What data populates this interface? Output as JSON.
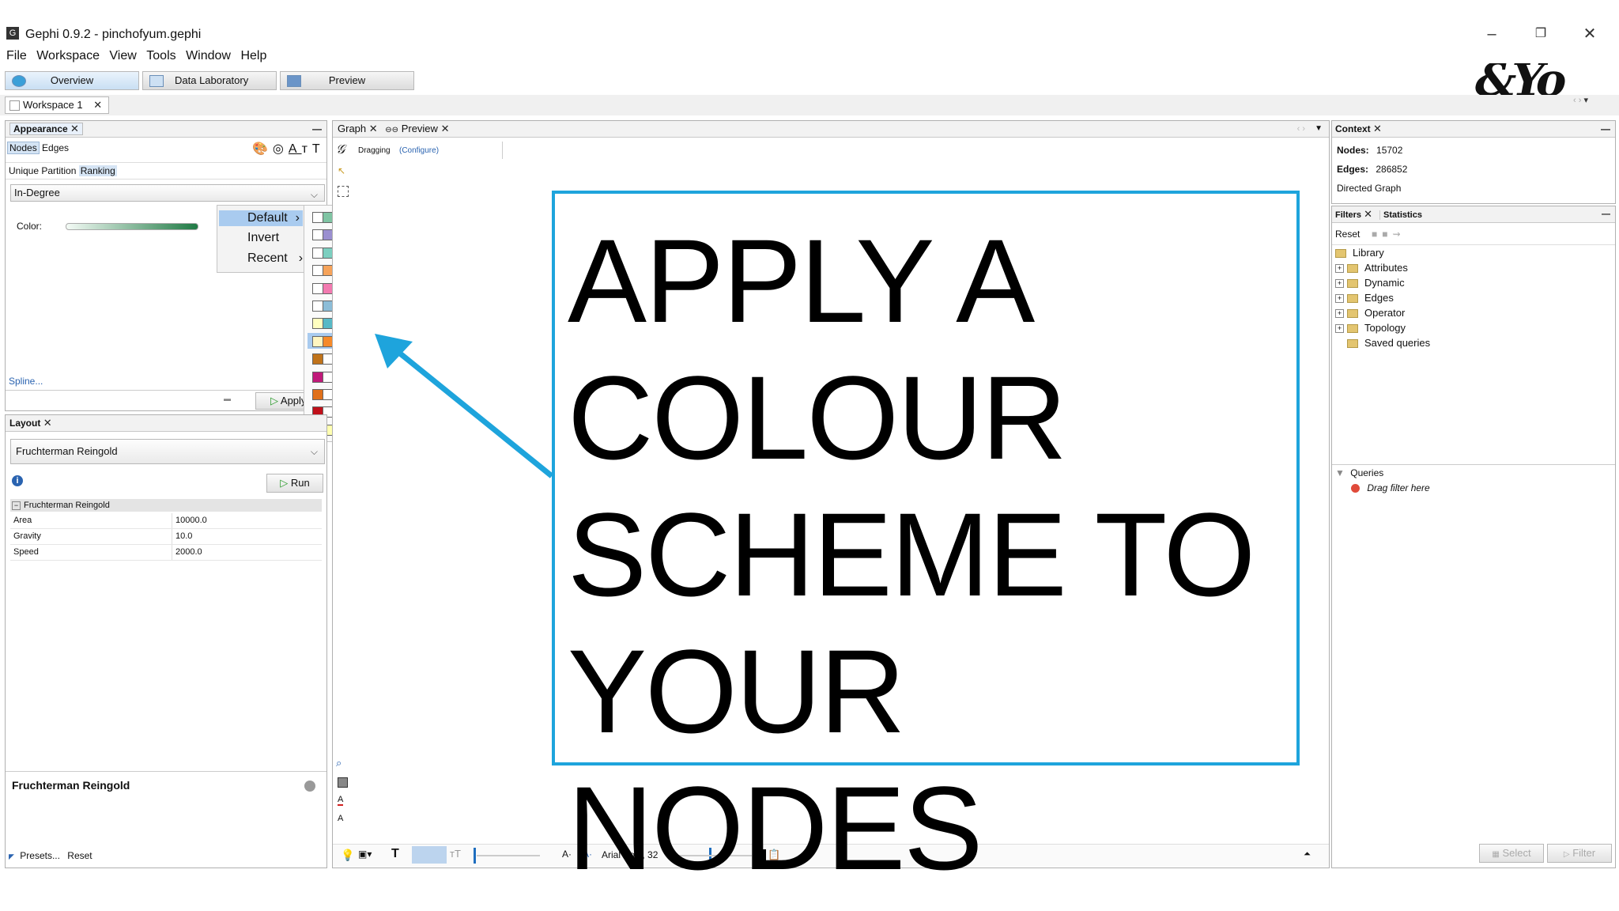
{
  "window": {
    "title": "Gephi 0.9.2 - pinchofyum.gephi",
    "app_icon": "gephi-logo-icon"
  },
  "menu": [
    "File",
    "Workspace",
    "View",
    "Tools",
    "Window",
    "Help"
  ],
  "perspectives": [
    {
      "label": "Overview",
      "active": true
    },
    {
      "label": "Data Laboratory"
    },
    {
      "label": "Preview"
    }
  ],
  "workspace_tab": "Workspace 1",
  "appearance": {
    "title": "Appearance",
    "target_tabs": [
      "Nodes",
      "Edges"
    ],
    "mode_tabs": [
      "Unique",
      "Partition",
      "Ranking"
    ],
    "attribute": "In-Degree",
    "color_label": "Color:",
    "spline_link": "Spline...",
    "apply_label": "Apply",
    "palette_menu": [
      "Default",
      "Invert",
      "Recent"
    ],
    "palettes": [
      [
        "#ffffff",
        "#7fc4a3",
        "#1f7a44"
      ],
      [
        "#ffffff",
        "#9a8fd0",
        "#7a1f8a"
      ],
      [
        "#ffffff",
        "#7ccfc0",
        "#1f6eaa"
      ],
      [
        "#ffffff",
        "#f6a35a",
        "#c41a1a"
      ],
      [
        "#ffffff",
        "#f27ab0",
        "#7a0f8a"
      ],
      [
        "#ffffff",
        "#8cbdd8",
        "#1f5590"
      ],
      [
        "#ffffc0",
        "#57b9c6",
        "#23318e"
      ],
      [
        "#fff5c0",
        "#f68a2a",
        "#a63a06"
      ],
      [
        "#c0731a",
        "#ffffff",
        "#1a8a7a"
      ],
      [
        "#c01a7a",
        "#ffffff",
        "#3aa01a"
      ],
      [
        "#e0701a",
        "#ffffff",
        "#6a4aa0"
      ],
      [
        "#c0101a",
        "#ffffff",
        "#404040"
      ],
      [
        "#d01a1a",
        "#ffffb0",
        "#2a6ab0"
      ]
    ]
  },
  "layout": {
    "title": "Layout",
    "algorithm": "Fruchterman Reingold",
    "run_label": "Run",
    "section": "Fruchterman Reingold",
    "properties": [
      {
        "name": "Area",
        "value": "10000.0"
      },
      {
        "name": "Gravity",
        "value": "10.0"
      },
      {
        "name": "Speed",
        "value": "2000.0"
      }
    ],
    "description_title": "Fruchterman Reingold",
    "presets_label": "Presets...",
    "reset_label": "Reset"
  },
  "graph": {
    "tabs": [
      "Graph",
      "Preview"
    ],
    "tool_label": "Dragging",
    "configure_link": "(Configure)",
    "font_label": "Arial Bold, 32"
  },
  "context": {
    "title": "Context",
    "nodes_label": "Nodes:",
    "nodes_value": "15702",
    "edges_label": "Edges:",
    "edges_value": "286852",
    "graph_type": "Directed Graph"
  },
  "filters": {
    "tabs": [
      "Filters",
      "Statistics"
    ],
    "reset_label": "Reset",
    "library": "Library",
    "items": [
      "Attributes",
      "Dynamic",
      "Edges",
      "Operator",
      "Topology",
      "Saved queries"
    ],
    "queries_label": "Queries",
    "drag_hint": "Drag filter here",
    "select_label": "Select",
    "filter_label": "Filter"
  },
  "overlay": {
    "lines": [
      "APPLY A",
      "COLOUR",
      "SCHEME TO",
      "YOUR NODES"
    ],
    "accent": "#1ea4dc"
  }
}
